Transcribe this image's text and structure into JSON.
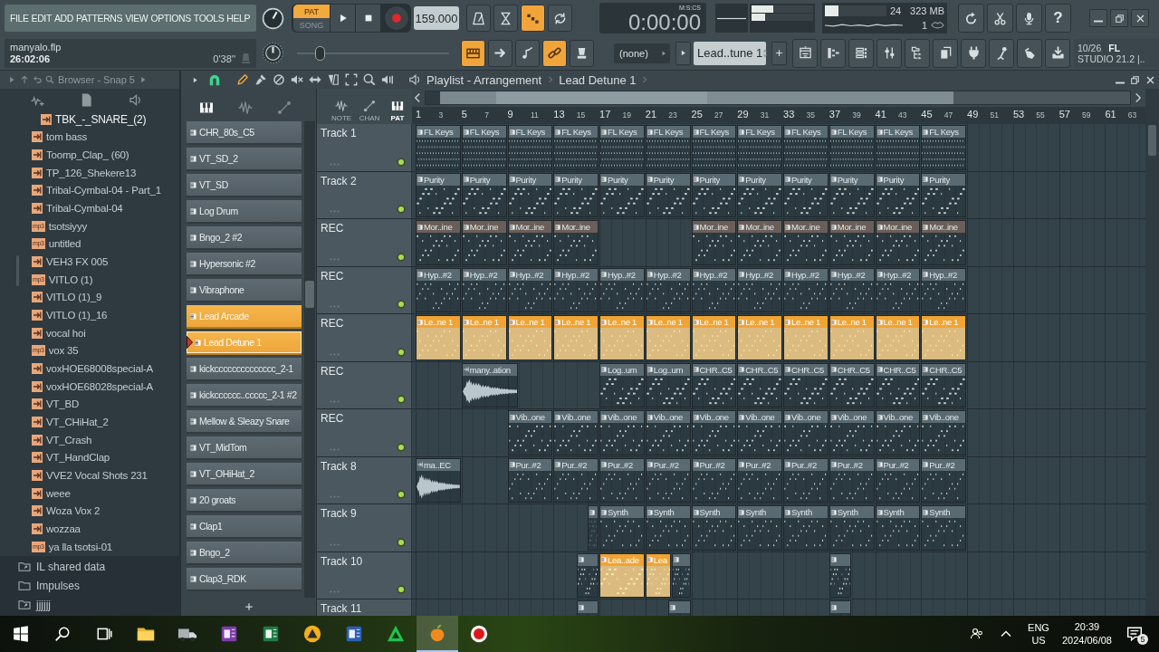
{
  "menu": [
    "FILE",
    "EDIT",
    "ADD",
    "PATTERNS",
    "VIEW",
    "OPTIONS",
    "TOOLS",
    "HELP"
  ],
  "project": {
    "file": "manyalo.flp",
    "elapsed": "26:02:06",
    "position": "0'38''"
  },
  "transport": {
    "modes": [
      {
        "label": "PAT",
        "selected": true
      },
      {
        "label": "SONG",
        "selected": false
      }
    ],
    "tempo": "159.000",
    "time": "0:00:00",
    "time_format": "M:S:CS"
  },
  "toggles_top": [
    {
      "kind": "metronome",
      "on": false
    },
    {
      "kind": "hourglass",
      "on": false
    },
    {
      "kind": "countdown",
      "on": true
    },
    {
      "kind": "loop",
      "on": false
    }
  ],
  "pitch": {
    "level": 0.13
  },
  "toggles": [
    {
      "kind": "keyboard",
      "on": true
    },
    {
      "kind": "arrow",
      "on": false
    },
    {
      "kind": "slide",
      "on": false
    },
    {
      "kind": "link",
      "on": true
    },
    {
      "kind": "cup",
      "on": false
    }
  ],
  "peak_meters": [
    {
      "level": 0.35
    },
    {
      "level": 0.22
    }
  ],
  "monitor": {
    "cpu": {
      "level": 0.22
    },
    "readings": [
      "24",
      "323 MB",
      "1"
    ]
  },
  "help": "?",
  "pattern_selector": {
    "source": "(none)",
    "pattern": "Lead..tune 1"
  },
  "news": {
    "date": "10/26",
    "brand": "FL",
    "text": "STUDIO 21.2 |.."
  },
  "browser": {
    "title": "Browser - Snap 5",
    "items": [
      {
        "name": "TBK_-_SNARE_(2)",
        "kind": "sample",
        "selected": true
      },
      {
        "name": "tom bass",
        "kind": "sample",
        "selected": false
      },
      {
        "name": "Toomp_Clap_ (60)",
        "kind": "sample",
        "selected": false
      },
      {
        "name": "TP_126_Shekere13",
        "kind": "sample",
        "selected": false
      },
      {
        "name": "Tribal-Cymbal-04 - Part_1",
        "kind": "sample",
        "selected": false
      },
      {
        "name": "Tribal-Cymbal-04",
        "kind": "sample",
        "selected": false
      },
      {
        "name": "tsotsiyyy",
        "kind": "mp3",
        "badge": "mp3",
        "selected": false
      },
      {
        "name": "untitled",
        "kind": "mp3",
        "badge": "mp3",
        "selected": false
      },
      {
        "name": "VEH3 FX 005",
        "kind": "sample",
        "selected": false
      },
      {
        "name": "VITLO (1)",
        "kind": "mp3",
        "badge": "mp3",
        "selected": false
      },
      {
        "name": "VITLO (1)_9",
        "kind": "sample",
        "selected": false
      },
      {
        "name": "VITLO (1)_16",
        "kind": "sample",
        "selected": false
      },
      {
        "name": "vocal hoi",
        "kind": "sample",
        "selected": false
      },
      {
        "name": "vox 35",
        "kind": "mp3",
        "badge": "mp3",
        "selected": false
      },
      {
        "name": "voxHOE68008special-A",
        "kind": "sample",
        "selected": false
      },
      {
        "name": "voxHOE68028special-A",
        "kind": "sample",
        "selected": false
      },
      {
        "name": "VT_BD",
        "kind": "sample",
        "selected": false
      },
      {
        "name": "VT_CHiHat_2",
        "kind": "sample",
        "selected": false
      },
      {
        "name": "VT_Crash",
        "kind": "sample",
        "selected": false
      },
      {
        "name": "VT_HandClap",
        "kind": "sample",
        "selected": false
      },
      {
        "name": "VVE2 Vocal Shots 231",
        "kind": "sample",
        "selected": false
      },
      {
        "name": "weee",
        "kind": "sample",
        "selected": false
      },
      {
        "name": "Woza Vox 2",
        "kind": "sample",
        "selected": false
      },
      {
        "name": "wozzaa",
        "kind": "sample",
        "selected": false
      },
      {
        "name": "ya lla tsotsi-01",
        "kind": "mp3",
        "badge": "mp3",
        "selected": false
      }
    ],
    "folders": [
      {
        "name": "IL shared data",
        "kind": "linked"
      },
      {
        "name": "Impulses",
        "kind": "plain"
      },
      {
        "name": "jjjjjj",
        "kind": "linked"
      }
    ]
  },
  "playlist": {
    "title": "Playlist - Arrangement",
    "pattern": "Lead Detune 1",
    "tools": [
      {
        "kind": "pencil",
        "selected": true
      },
      {
        "kind": "brush",
        "selected": false
      },
      {
        "kind": "delete",
        "selected": false
      },
      {
        "kind": "mute",
        "selected": false
      },
      {
        "kind": "slip",
        "selected": false
      },
      {
        "kind": "slice",
        "selected": false
      },
      {
        "kind": "select",
        "selected": false
      },
      {
        "kind": "zoom",
        "selected": false
      },
      {
        "kind": "playback",
        "selected": false
      }
    ],
    "picker_tabs": [
      {
        "kind": "keys",
        "selected": true
      },
      {
        "kind": "wave",
        "selected": false
      },
      {
        "kind": "curve",
        "selected": false
      }
    ],
    "channels": [
      {
        "name": "CHR_80s_C5",
        "selected": false,
        "current": false
      },
      {
        "name": "VT_SD_2",
        "selected": false,
        "current": false
      },
      {
        "name": "VT_SD",
        "selected": false,
        "current": false
      },
      {
        "name": "Log Drum",
        "selected": false,
        "current": false
      },
      {
        "name": "Bngo_2 #2",
        "selected": false,
        "current": false
      },
      {
        "name": "Hypersonic #2",
        "selected": false,
        "current": false
      },
      {
        "name": "Vibraphone",
        "selected": false,
        "current": false
      },
      {
        "name": "Lead Arcade",
        "selected": true,
        "current": false
      },
      {
        "name": "Lead Detune 1",
        "selected": true,
        "current": true
      },
      {
        "name": "kickcccccccccccccc_2-1",
        "selected": false,
        "current": false
      },
      {
        "name": "kickcccccc..ccccc_2-1 #2",
        "selected": false,
        "current": false
      },
      {
        "name": "Mellow & Sleazy Snare",
        "selected": false,
        "current": false
      },
      {
        "name": "VT_MidTom",
        "selected": false,
        "current": false
      },
      {
        "name": "VT_OHiHat_2",
        "selected": false,
        "current": false
      },
      {
        "name": "20 groats",
        "selected": false,
        "current": false
      },
      {
        "name": "Clap1",
        "selected": false,
        "current": false
      },
      {
        "name": "Bngo_2",
        "selected": false,
        "current": false
      },
      {
        "name": "Clap3_RDK",
        "selected": false,
        "current": false
      }
    ],
    "filters": [
      {
        "label": "NOTE",
        "kind": "wave",
        "selected": false
      },
      {
        "label": "CHAN",
        "kind": "curve",
        "selected": false
      },
      {
        "label": "PAT",
        "kind": "keys",
        "selected": true
      }
    ],
    "ruler": [
      "1",
      "3",
      "5",
      "7",
      "9",
      "11",
      "13",
      "15",
      "17",
      "19",
      "21",
      "23",
      "25",
      "27",
      "29",
      "31",
      "33",
      "35",
      "37",
      "39",
      "41",
      "43",
      "45",
      "47",
      "49",
      "51",
      "53",
      "55",
      "57",
      "59",
      "61",
      "63"
    ],
    "tracks": [
      {
        "name": "Track 1",
        "enabled": true,
        "clips": [
          {
            "label": "FL Keys",
            "kind": "pattern",
            "color": "#5a6a72"
          },
          {
            "label": "FL Keys",
            "kind": "pattern",
            "color": "#5a6a72"
          },
          {
            "label": "FL Keys",
            "kind": "pattern",
            "color": "#5a6a72"
          },
          {
            "label": "FL Keys",
            "kind": "pattern",
            "color": "#5a6a72"
          },
          {
            "label": "FL Keys",
            "kind": "pattern",
            "color": "#5a6a72"
          },
          {
            "label": "FL Keys",
            "kind": "pattern",
            "color": "#5a6a72"
          },
          {
            "label": "FL Keys",
            "kind": "pattern",
            "color": "#5a6a72"
          },
          {
            "label": "FL Keys",
            "kind": "pattern",
            "color": "#5a6a72"
          },
          {
            "label": "FL Keys",
            "kind": "pattern",
            "color": "#5a6a72"
          },
          {
            "label": "FL Keys",
            "kind": "pattern",
            "color": "#5a6a72"
          },
          {
            "label": "FL Keys",
            "kind": "pattern",
            "color": "#5a6a72"
          },
          {
            "label": "FL Keys",
            "kind": "pattern",
            "color": "#5a6a72"
          }
        ]
      },
      {
        "name": "Track 2",
        "enabled": true,
        "clips": [
          {
            "label": "Purity",
            "kind": "pattern",
            "color": "#5a6a72"
          },
          {
            "label": "Purity",
            "kind": "pattern",
            "color": "#5a6a72"
          },
          {
            "label": "Purity",
            "kind": "pattern",
            "color": "#5a6a72"
          },
          {
            "label": "Purity",
            "kind": "pattern",
            "color": "#5a6a72"
          },
          {
            "label": "Purity",
            "kind": "pattern",
            "color": "#5a6a72"
          },
          {
            "label": "Purity",
            "kind": "pattern",
            "color": "#5a6a72"
          },
          {
            "label": "Purity",
            "kind": "pattern",
            "color": "#5a6a72"
          },
          {
            "label": "Purity",
            "kind": "pattern",
            "color": "#5a6a72"
          },
          {
            "label": "Purity",
            "kind": "pattern",
            "color": "#5a6a72"
          },
          {
            "label": "Purity",
            "kind": "pattern",
            "color": "#5a6a72"
          },
          {
            "label": "Purity",
            "kind": "pattern",
            "color": "#5a6a72"
          },
          {
            "label": "Purity",
            "kind": "pattern",
            "color": "#5a6a72"
          }
        ]
      },
      {
        "name": "REC",
        "enabled": true,
        "clips": [
          {
            "label": "Mor..ine",
            "kind": "pattern",
            "color": "#6b5e58"
          },
          {
            "label": "Mor..ine",
            "kind": "pattern",
            "color": "#6b5e58"
          },
          {
            "label": "Mor..ine",
            "kind": "pattern",
            "color": "#6b5e58"
          },
          {
            "label": "Mor..ine",
            "kind": "pattern",
            "color": "#6b5e58"
          },
          {
            "label": "Mor..ine",
            "kind": "pattern",
            "color": "#6b5e58"
          },
          {
            "label": "Mor..ine",
            "kind": "pattern",
            "color": "#6b5e58"
          },
          {
            "label": "Mor..ine",
            "kind": "pattern",
            "color": "#6b5e58"
          },
          {
            "label": "Mor..ine",
            "kind": "pattern",
            "color": "#6b5e58"
          },
          {
            "label": "Mor..ine",
            "kind": "pattern",
            "color": "#6b5e58"
          },
          {
            "label": "Mor..ine",
            "kind": "pattern",
            "color": "#6b5e58"
          }
        ]
      },
      {
        "name": "REC",
        "enabled": true,
        "clips": [
          {
            "label": "Hyp..#2",
            "kind": "pattern",
            "color": "#5a6a72"
          },
          {
            "label": "Hyp..#2",
            "kind": "pattern",
            "color": "#5a6a72"
          },
          {
            "label": "Hyp..#2",
            "kind": "pattern",
            "color": "#5a6a72"
          },
          {
            "label": "Hyp..#2",
            "kind": "pattern",
            "color": "#5a6a72"
          },
          {
            "label": "Hyp..#2",
            "kind": "pattern",
            "color": "#5a6a72"
          },
          {
            "label": "Hyp..#2",
            "kind": "pattern",
            "color": "#5a6a72"
          },
          {
            "label": "Hyp..#2",
            "kind": "pattern",
            "color": "#5a6a72"
          },
          {
            "label": "Hyp..#2",
            "kind": "pattern",
            "color": "#5a6a72"
          },
          {
            "label": "Hyp..#2",
            "kind": "pattern",
            "color": "#5a6a72"
          },
          {
            "label": "Hyp..#2",
            "kind": "pattern",
            "color": "#5a6a72"
          },
          {
            "label": "Hyp..#2",
            "kind": "pattern",
            "color": "#5a6a72"
          },
          {
            "label": "Hyp..#2",
            "kind": "pattern",
            "color": "#5a6a72"
          }
        ]
      },
      {
        "name": "REC",
        "enabled": true,
        "clips": [
          {
            "label": "Le..ne 1",
            "kind": "pattern",
            "color": "#f0a434"
          },
          {
            "label": "Le..ne 1",
            "kind": "pattern",
            "color": "#f0a434"
          },
          {
            "label": "Le..ne 1",
            "kind": "pattern",
            "color": "#f0a434"
          },
          {
            "label": "Le..ne 1",
            "kind": "pattern",
            "color": "#f0a434"
          },
          {
            "label": "Le..ne 1",
            "kind": "pattern",
            "color": "#f0a434"
          },
          {
            "label": "Le..ne 1",
            "kind": "pattern",
            "color": "#f0a434"
          },
          {
            "label": "Le..ne 1",
            "kind": "pattern",
            "color": "#f0a434"
          },
          {
            "label": "Le..ne 1",
            "kind": "pattern",
            "color": "#f0a434"
          },
          {
            "label": "Le..ne 1",
            "kind": "pattern",
            "color": "#f0a434"
          },
          {
            "label": "Le..ne 1",
            "kind": "pattern",
            "color": "#f0a434"
          },
          {
            "label": "Le..ne 1",
            "kind": "pattern",
            "color": "#f0a434"
          },
          {
            "label": "Le..ne 1",
            "kind": "pattern",
            "color": "#f0a434"
          }
        ]
      },
      {
        "name": "REC",
        "enabled": true,
        "clips": [
          {
            "label": "many..ation",
            "kind": "audio",
            "color": "#5a6a72"
          },
          {
            "label": "Log..um",
            "kind": "pattern",
            "color": "#5a6a72"
          },
          {
            "label": "Log..um",
            "kind": "pattern",
            "color": "#5a6a72"
          },
          {
            "label": "CHR..C5",
            "kind": "pattern",
            "color": "#5a6a72"
          },
          {
            "label": "CHR..C5",
            "kind": "pattern",
            "color": "#5a6a72"
          },
          {
            "label": "CHR..C5",
            "kind": "pattern",
            "color": "#5a6a72"
          },
          {
            "label": "CHR..C5",
            "kind": "pattern",
            "color": "#5a6a72"
          },
          {
            "label": "CHR..C5",
            "kind": "pattern",
            "color": "#5a6a72"
          },
          {
            "label": "CHR..C5",
            "kind": "pattern",
            "color": "#5a6a72"
          }
        ]
      },
      {
        "name": "REC",
        "enabled": true,
        "clips": [
          {
            "label": "Vib..one",
            "kind": "pattern",
            "color": "#5a6a72"
          },
          {
            "label": "Vib..one",
            "kind": "pattern",
            "color": "#5a6a72"
          },
          {
            "label": "Vib..one",
            "kind": "pattern",
            "color": "#5a6a72"
          },
          {
            "label": "Vib..one",
            "kind": "pattern",
            "color": "#5a6a72"
          },
          {
            "label": "Vib..one",
            "kind": "pattern",
            "color": "#5a6a72"
          },
          {
            "label": "Vib..one",
            "kind": "pattern",
            "color": "#5a6a72"
          },
          {
            "label": "Vib..one",
            "kind": "pattern",
            "color": "#5a6a72"
          },
          {
            "label": "Vib..one",
            "kind": "pattern",
            "color": "#5a6a72"
          },
          {
            "label": "Vib..one",
            "kind": "pattern",
            "color": "#5a6a72"
          },
          {
            "label": "Vib..one",
            "kind": "pattern",
            "color": "#5a6a72"
          }
        ]
      },
      {
        "name": "Track 8",
        "enabled": true,
        "clips": [
          {
            "label": "ma..EC",
            "kind": "audio",
            "color": "#5a6a72"
          },
          {
            "label": "Pur..#2",
            "kind": "pattern",
            "color": "#5a6a72"
          },
          {
            "label": "Pur..#2",
            "kind": "pattern",
            "color": "#5a6a72"
          },
          {
            "label": "Pur..#2",
            "kind": "pattern",
            "color": "#5a6a72"
          },
          {
            "label": "Pur..#2",
            "kind": "pattern",
            "color": "#5a6a72"
          },
          {
            "label": "Pur..#2",
            "kind": "pattern",
            "color": "#5a6a72"
          },
          {
            "label": "Pur..#2",
            "kind": "pattern",
            "color": "#5a6a72"
          },
          {
            "label": "Pur..#2",
            "kind": "pattern",
            "color": "#5a6a72"
          },
          {
            "label": "Pur..#2",
            "kind": "pattern",
            "color": "#5a6a72"
          },
          {
            "label": "Pur..#2",
            "kind": "pattern",
            "color": "#5a6a72"
          },
          {
            "label": "Pur..#2",
            "kind": "pattern",
            "color": "#5a6a72"
          }
        ]
      },
      {
        "name": "Track 9",
        "enabled": true,
        "clips": [
          {
            "kind": "pattern",
            "color": "#5a6a72"
          },
          {
            "label": "Synth",
            "kind": "pattern",
            "color": "#5a6a72"
          },
          {
            "label": "Synth",
            "kind": "pattern",
            "color": "#5a6a72"
          },
          {
            "label": "Synth",
            "kind": "pattern",
            "color": "#5a6a72"
          },
          {
            "label": "Synth",
            "kind": "pattern",
            "color": "#5a6a72"
          },
          {
            "label": "Synth",
            "kind": "pattern",
            "color": "#5a6a72"
          },
          {
            "label": "Synth",
            "kind": "pattern",
            "color": "#5a6a72"
          },
          {
            "label": "Synth",
            "kind": "pattern",
            "color": "#5a6a72"
          },
          {
            "label": "Synth",
            "kind": "pattern",
            "color": "#5a6a72"
          }
        ]
      },
      {
        "name": "Track 10",
        "enabled": true,
        "clips": [
          {
            "kind": "pattern",
            "color": "#5a6a72"
          },
          {
            "label": "Lea..ade",
            "kind": "pattern",
            "color": "#f0a434"
          },
          {
            "label": "Lea",
            "kind": "pattern",
            "color": "#f0a434"
          },
          {
            "kind": "pattern",
            "color": "#5a6a72"
          },
          {
            "kind": "pattern",
            "color": "#5a6a72"
          }
        ]
      },
      {
        "name": "Track 11",
        "clips": [
          {
            "kind": "pattern",
            "color": "#5a6a72"
          },
          {
            "kind": "pattern",
            "color": "#5a6a72"
          },
          {
            "kind": "pattern",
            "color": "#5a6a72"
          }
        ]
      }
    ]
  },
  "taskbar": {
    "apps": [
      {
        "kind": "folder",
        "selected": false
      },
      {
        "kind": "truck",
        "selected": false
      },
      {
        "kind": "notebook",
        "selected": false
      },
      {
        "kind": "sheet",
        "selected": false
      },
      {
        "kind": "circle",
        "selected": false
      },
      {
        "kind": "document",
        "selected": false
      },
      {
        "kind": "triangle",
        "selected": false
      },
      {
        "kind": "fruit",
        "selected": true
      },
      {
        "kind": "record",
        "selected": false
      }
    ],
    "language": [
      "ENG",
      "US"
    ],
    "time": "20:39",
    "date": "2024/06/08",
    "notifications": "5"
  }
}
